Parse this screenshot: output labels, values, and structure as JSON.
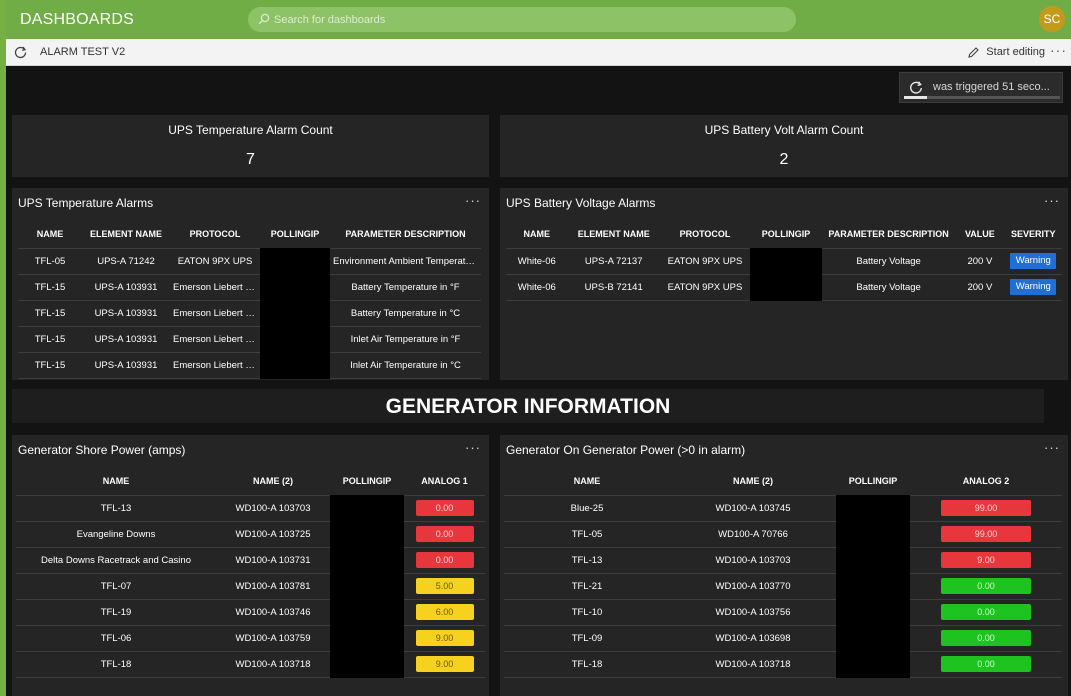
{
  "header": {
    "app_title": "DASHBOARDS",
    "search_placeholder": "Search for dashboards",
    "avatar_initials": "SC"
  },
  "subbar": {
    "dashboard_name": "ALARM TEST V2",
    "edit_label": "Start editing",
    "more_label": "···"
  },
  "toast": {
    "text": "was triggered 51 seco...",
    "progress": 0.15
  },
  "kpis": [
    {
      "title": "UPS Temperature Alarm Count",
      "value": "7"
    },
    {
      "title": "UPS Battery Volt Alarm Count",
      "value": "2"
    }
  ],
  "ups_temp": {
    "title": "UPS Temperature Alarms",
    "more": "···",
    "columns": [
      "NAME",
      "ELEMENT NAME",
      "PROTOCOL",
      "POLLINGIP",
      "PARAMETER DESCRIPTION"
    ],
    "rows": [
      [
        "TFL-05",
        "UPS-A 71242",
        "EATON 9PX UPS",
        "",
        "Environment Ambient Temperatu..."
      ],
      [
        "TFL-15",
        "UPS-A 103931",
        "Emerson Liebert G...",
        "",
        "Battery Temperature in °F"
      ],
      [
        "TFL-15",
        "UPS-A 103931",
        "Emerson Liebert G...",
        "",
        "Battery Temperature in °C"
      ],
      [
        "TFL-15",
        "UPS-A 103931",
        "Emerson Liebert G...",
        "",
        "Inlet Air Temperature in °F"
      ],
      [
        "TFL-15",
        "UPS-A 103931",
        "Emerson Liebert G...",
        "",
        "Inlet Air Temperature in °C"
      ]
    ]
  },
  "ups_batt": {
    "title": "UPS Battery Voltage Alarms",
    "more": "···",
    "columns": [
      "NAME",
      "ELEMENT NAME",
      "PROTOCOL",
      "POLLINGIP",
      "PARAMETER DESCRIPTION",
      "VALUE",
      "SEVERITY"
    ],
    "rows": [
      [
        "White-06",
        "UPS-A 72137",
        "EATON 9PX UPS",
        "",
        "Battery Voltage",
        "200 V",
        "Warning"
      ],
      [
        "White-06",
        "UPS-B 72141",
        "EATON 9PX UPS",
        "",
        "Battery Voltage",
        "200 V",
        "Warning"
      ]
    ],
    "severity_color": "#1f6fd6"
  },
  "section": {
    "title": "GENERATOR INFORMATION"
  },
  "gen_shore": {
    "title": "Generator Shore Power (amps)",
    "more": "···",
    "columns": [
      "NAME",
      "NAME (2)",
      "POLLINGIP",
      "ANALOG 1"
    ],
    "rows": [
      [
        "TFL-13",
        "WD100-A 103703",
        "",
        "0.00",
        "red"
      ],
      [
        "Evangeline Downs",
        "WD100-A 103725",
        "",
        "0.00",
        "red"
      ],
      [
        "Delta Downs Racetrack and Casino",
        "WD100-A 103731",
        "",
        "0.00",
        "red"
      ],
      [
        "TFL-07",
        "WD100-A 103781",
        "",
        "5.00",
        "yellow"
      ],
      [
        "TFL-19",
        "WD100-A 103746",
        "",
        "6.00",
        "yellow"
      ],
      [
        "TFL-06",
        "WD100-A 103759",
        "",
        "9.00",
        "yellow"
      ],
      [
        "TFL-18",
        "WD100-A 103718",
        "",
        "9.00",
        "yellow"
      ]
    ]
  },
  "gen_on": {
    "title": "Generator On Generator Power (>0 in alarm)",
    "more": "···",
    "columns": [
      "NAME",
      "NAME (2)",
      "POLLINGIP",
      "ANALOG 2"
    ],
    "rows": [
      [
        "Blue-25",
        "WD100-A 103745",
        "",
        "99.00",
        "red"
      ],
      [
        "TFL-05",
        "WD100-A 70766",
        "",
        "99.00",
        "red"
      ],
      [
        "TFL-13",
        "WD100-A 103703",
        "",
        "9.00",
        "red"
      ],
      [
        "TFL-21",
        "WD100-A 103770",
        "",
        "0.00",
        "green"
      ],
      [
        "TFL-10",
        "WD100-A 103756",
        "",
        "0.00",
        "green"
      ],
      [
        "TFL-09",
        "WD100-A 103698",
        "",
        "0.00",
        "green"
      ],
      [
        "TFL-18",
        "WD100-A 103718",
        "",
        "0.00",
        "green"
      ]
    ]
  },
  "colors": {
    "header_green": "#70ad47",
    "alarm_red": "#e8363d",
    "alarm_yellow": "#f6d21f",
    "ok_green": "#1fc31f",
    "canvas": "#131313",
    "tile": "#252525"
  }
}
